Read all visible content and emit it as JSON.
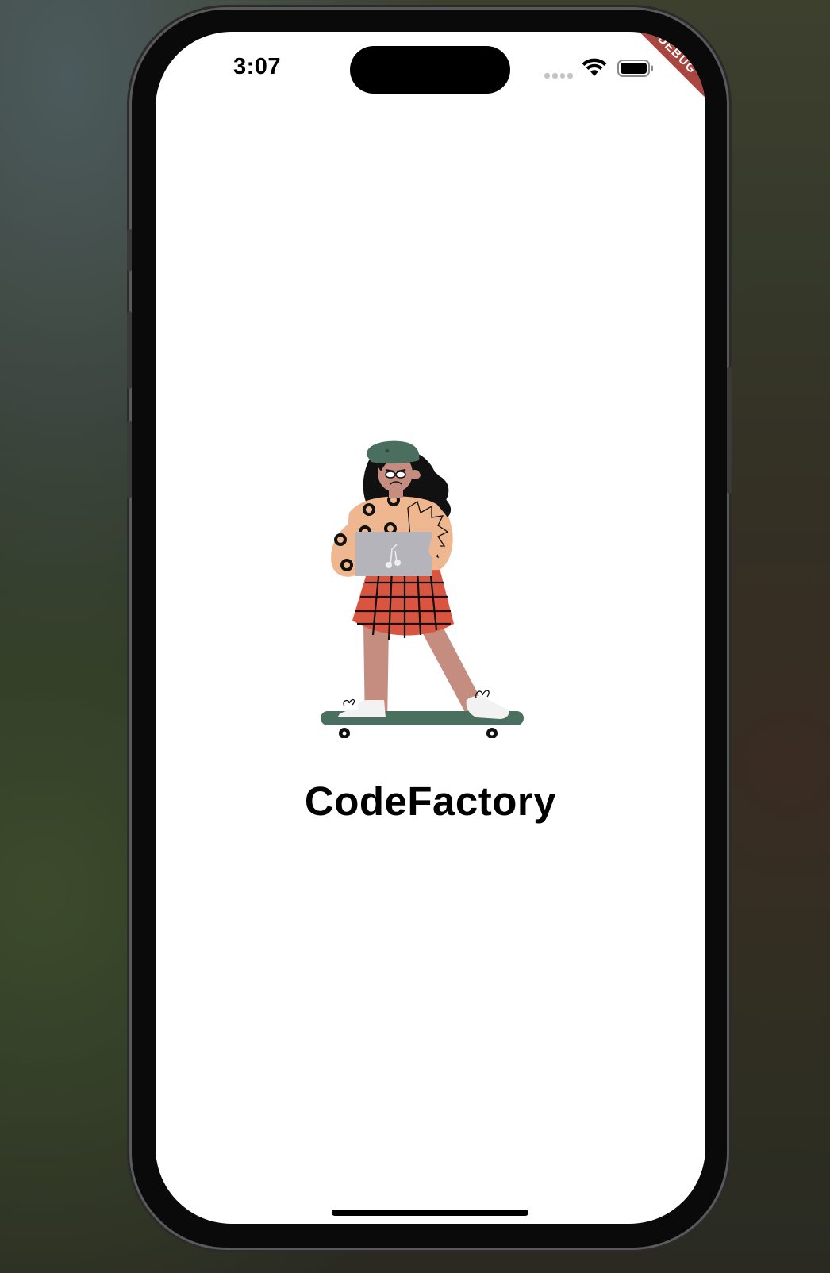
{
  "status_bar": {
    "time": "3:07",
    "signal_icon": "cellular-signal-icon",
    "wifi_icon": "wifi-icon",
    "battery_icon": "battery-icon"
  },
  "debug_banner": {
    "label": "DEBUG",
    "color": "#a8463f"
  },
  "splash": {
    "illustration": "girl-on-skateboard-with-laptop-illustration",
    "title": "CodeFactory"
  },
  "colors": {
    "screen_background": "#ffffff",
    "skateboard_green": "#4a6f5e",
    "skirt_red": "#d9553f",
    "sweater_peach": "#efb78f",
    "laptop_gray": "#b6b4bb",
    "skin": "#c58d80"
  }
}
